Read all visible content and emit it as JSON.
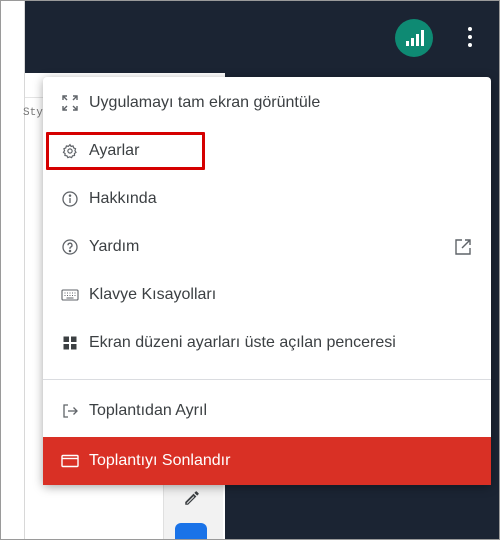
{
  "background": {
    "doc_hint_text": "Sty",
    "accent_dark": "#1b2433",
    "accent_blue": "#1a73e8"
  },
  "header": {
    "signal_icon": "signal-bars-icon",
    "signal_color": "#0e8a73",
    "more_icon": "more-vert-icon"
  },
  "menu": {
    "items": [
      {
        "label": "Uygulamayı tam ekran görüntüle",
        "icon": "fullscreen-icon"
      },
      {
        "label": "Ayarlar",
        "icon": "gear-icon"
      },
      {
        "label": "Hakkında",
        "icon": "info-icon"
      },
      {
        "label": "Yardım",
        "icon": "help-icon",
        "trailing_icon": "open-in-new-icon"
      },
      {
        "label": "Klavye Kısayolları",
        "icon": "keyboard-icon"
      },
      {
        "label": "Ekran düzeni ayarları üste açılan penceresi",
        "icon": "layout-icon"
      },
      {
        "label": "Toplantıdan Ayrıl",
        "icon": "leave-icon"
      },
      {
        "label": "Toplantıyı Sonlandır",
        "icon": "end-meeting-icon",
        "color": "#d93025"
      }
    ]
  },
  "annotation": {
    "highlight_color": "#d50000"
  }
}
